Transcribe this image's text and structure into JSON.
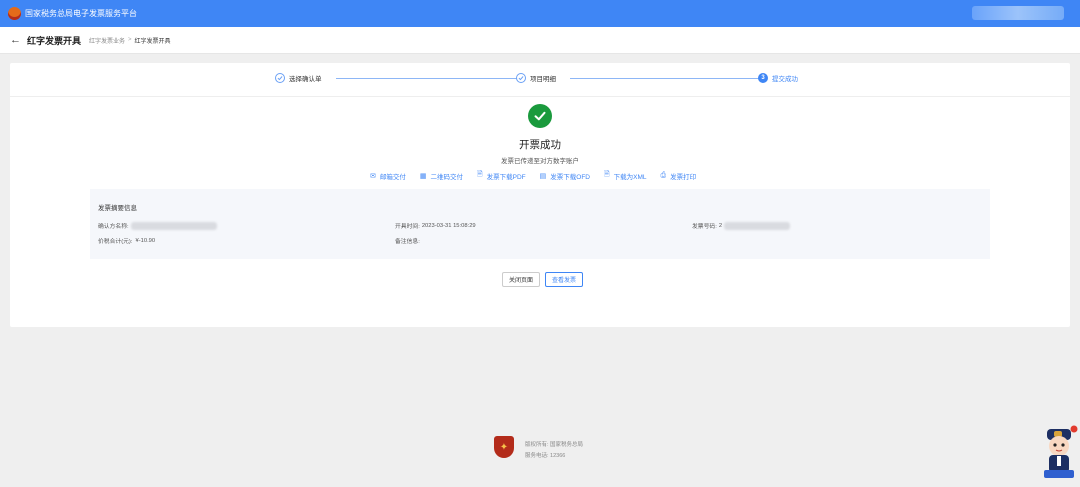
{
  "app": {
    "title": "国家税务总局电子发票服务平台"
  },
  "breadcrumb": {
    "back_icon": "←",
    "page_title": "红字发票开具",
    "items": [
      "红字发票业务",
      "红字发票开具"
    ],
    "separator": ">"
  },
  "steps": [
    {
      "label": "选择确认单",
      "status": "done",
      "icon": "check"
    },
    {
      "label": "项目明细",
      "status": "done",
      "icon": "check"
    },
    {
      "label": "提交成功",
      "status": "current",
      "number": "3"
    }
  ],
  "result": {
    "title": "开票成功",
    "subtitle": "发票已传递至对方数字账户"
  },
  "actions": [
    {
      "label": "邮箱交付",
      "icon": "mail-icon"
    },
    {
      "label": "二维码交付",
      "icon": "qrcode-icon"
    },
    {
      "label": "发票下载PDF",
      "icon": "download-pdf-icon"
    },
    {
      "label": "发票下载OFD",
      "icon": "download-ofd-icon"
    },
    {
      "label": "下载为XML",
      "icon": "download-xml-icon"
    },
    {
      "label": "发票打印",
      "icon": "print-icon"
    }
  ],
  "summary": {
    "title": "发票摘要信息",
    "buyer_label": "确认方名称:",
    "issue_time_label": "开具时间:",
    "issue_time_value": "2023-03-31 15:08:29",
    "invoice_no_label": "发票号码:",
    "invoice_no_prefix": "2",
    "total_label": "价税合计(元):",
    "total_value": "¥-10.90",
    "remark_label": "备注信息:"
  },
  "buttons": {
    "close": "关闭页面",
    "view": "查看发票"
  },
  "footer": {
    "copyright": "版权所有:  国家税务总局",
    "hotline": "服务电话:  12366"
  },
  "colors": {
    "primary": "#3f86f5",
    "success": "#1a9a3d"
  }
}
